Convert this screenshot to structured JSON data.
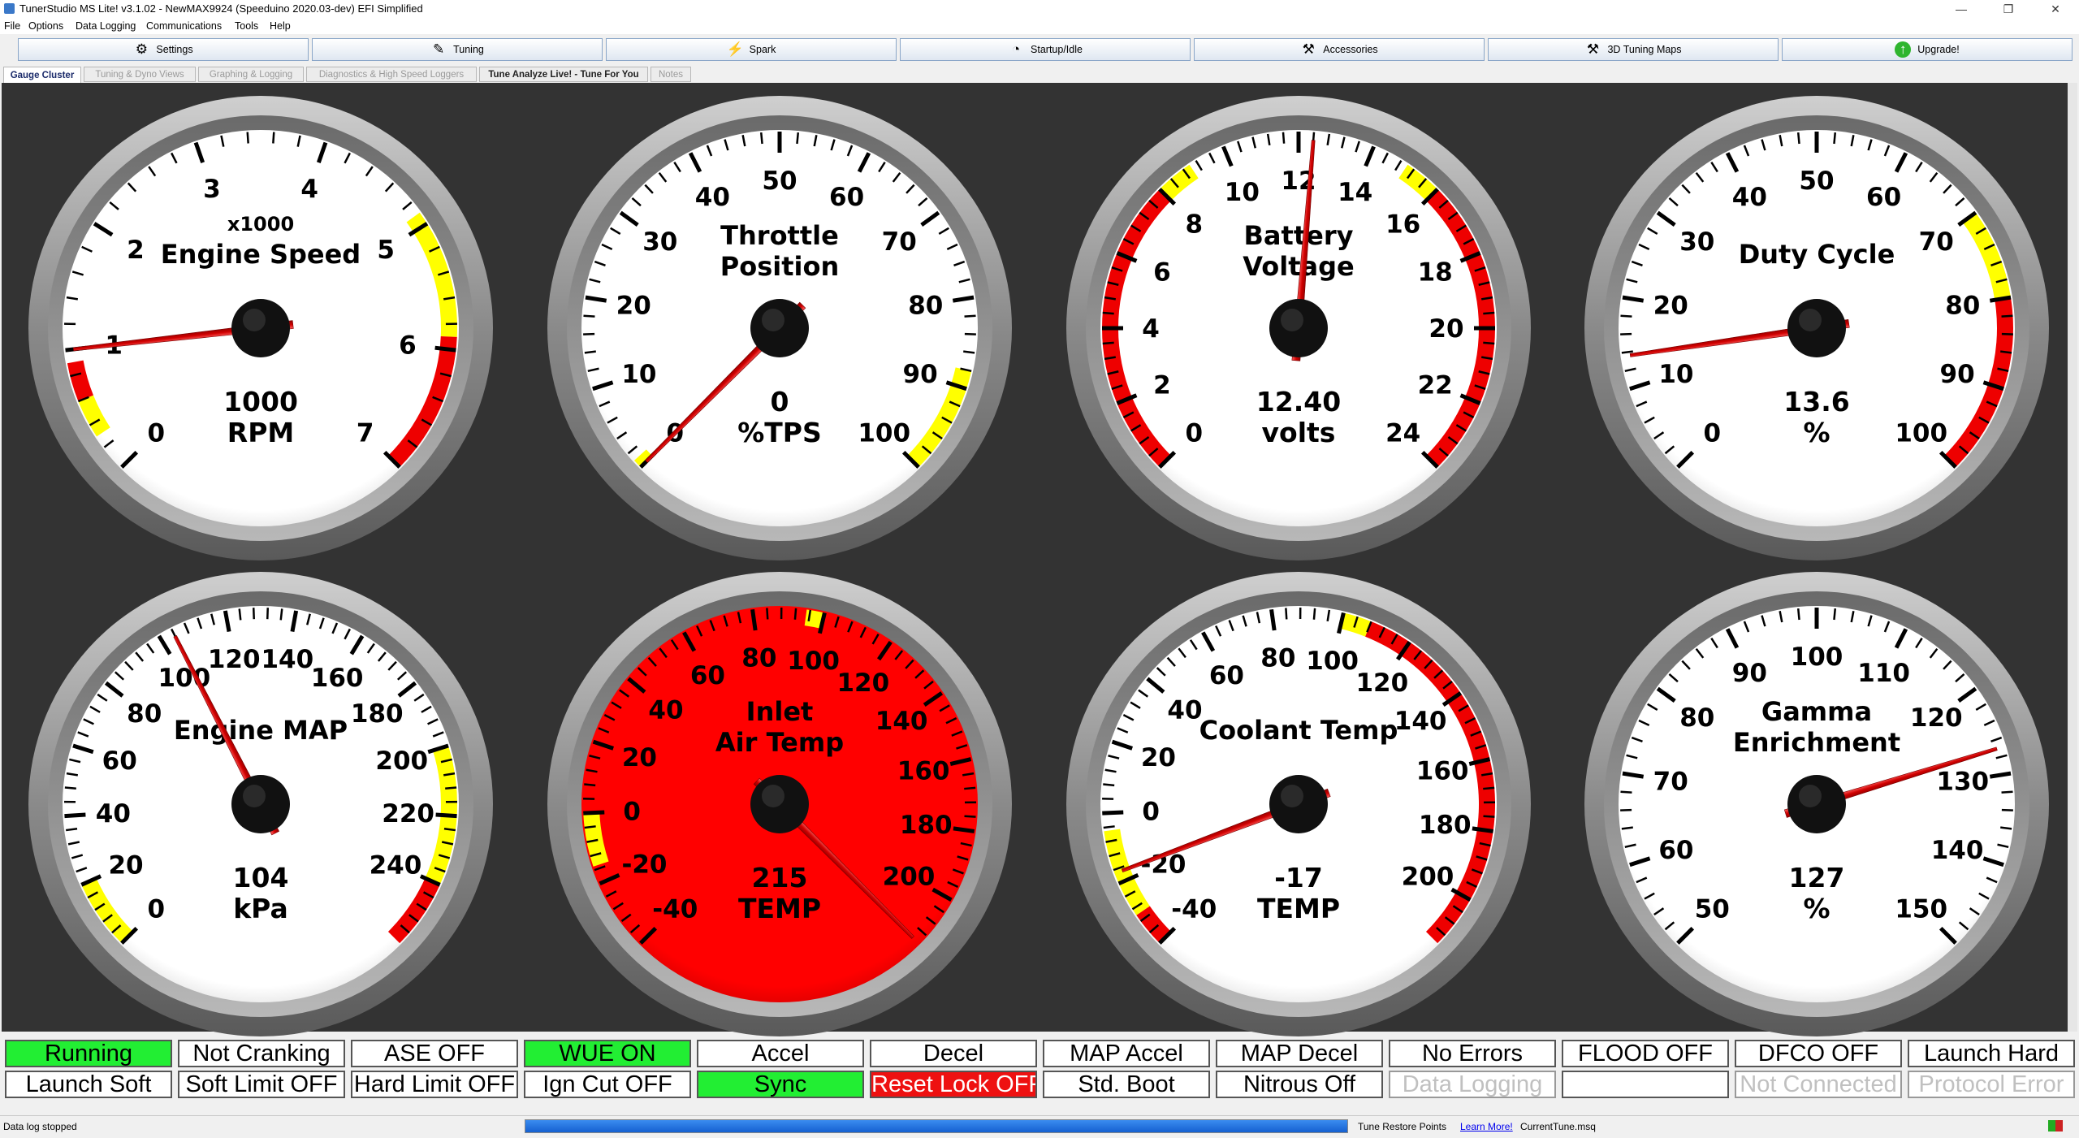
{
  "window": {
    "title": "TunerStudio MS Lite! v3.1.02 - NewMAX9924 (Speeduino 2020.03-dev) EFI Simplified",
    "controls": [
      "—",
      "❐",
      "✕"
    ]
  },
  "menu": [
    "File",
    "Options",
    "Data Logging",
    "Communications",
    "Tools",
    "Help"
  ],
  "toolbar": [
    {
      "label": "Settings",
      "icon": "⚙"
    },
    {
      "label": "Tuning",
      "icon": "✎"
    },
    {
      "label": "Spark",
      "icon": "⚡"
    },
    {
      "label": "Startup/Idle",
      "icon": "◔"
    },
    {
      "label": "Accessories",
      "icon": "⚒"
    },
    {
      "label": "3D Tuning Maps",
      "icon": "⚒"
    },
    {
      "label": "Upgrade!",
      "icon": "↑"
    }
  ],
  "tabs": [
    "Gauge Cluster",
    "Tuning & Dyno Views",
    "Graphing & Logging",
    "Diagnostics & High Speed Loggers",
    "Tune Analyze Live! - Tune For You",
    "Notes"
  ],
  "gauges": [
    {
      "title": [
        "Engine Speed"
      ],
      "subtitle": "x1000",
      "min": 0,
      "max": 7,
      "labels": [
        "0",
        "1",
        "2",
        "3",
        "4",
        "5",
        "6",
        "7"
      ],
      "value": 1.0,
      "value_text": "1000",
      "units": "RPM",
      "bands": [
        {
          "from": 0.3,
          "to": 0.6,
          "color": "#ffff00"
        },
        {
          "from": 0.6,
          "to": 0.9,
          "color": "#ee0000"
        },
        {
          "from": 4.9,
          "to": 5.9,
          "color": "#ffff00"
        },
        {
          "from": 5.9,
          "to": 7,
          "color": "#ee0000"
        }
      ],
      "face": "#ffffff"
    },
    {
      "title": [
        "Throttle",
        "Position"
      ],
      "subtitle": "",
      "min": 0,
      "max": 100,
      "labels": [
        "0",
        "10",
        "20",
        "30",
        "40",
        "50",
        "60",
        "70",
        "80",
        "90",
        "100"
      ],
      "value": 0,
      "value_text": "0",
      "units": "%TPS",
      "bands": [
        {
          "from": 0,
          "to": 1,
          "color": "#ffff00"
        },
        {
          "from": 88,
          "to": 100,
          "color": "#ffff00"
        }
      ],
      "face": "#ffffff"
    },
    {
      "title": [
        "Battery",
        "Voltage"
      ],
      "subtitle": "",
      "min": 0,
      "max": 24,
      "labels": [
        "0",
        "2",
        "4",
        "6",
        "8",
        "10",
        "12",
        "14",
        "16",
        "18",
        "20",
        "22",
        "24"
      ],
      "value": 12.4,
      "value_text": "12.40",
      "units": "volts",
      "bands": [
        {
          "from": 0,
          "to": 8,
          "color": "#ee0000"
        },
        {
          "from": 8,
          "to": 9,
          "color": "#ffff00"
        },
        {
          "from": 15,
          "to": 16,
          "color": "#ffff00"
        },
        {
          "from": 16,
          "to": 24,
          "color": "#ee0000"
        }
      ],
      "face": "#ffffff"
    },
    {
      "title": [
        "Duty Cycle"
      ],
      "subtitle": "",
      "min": 0,
      "max": 100,
      "labels": [
        "0",
        "10",
        "20",
        "30",
        "40",
        "50",
        "60",
        "70",
        "80",
        "90",
        "100"
      ],
      "value": 13.6,
      "value_text": "13.6",
      "units": "%",
      "bands": [
        {
          "from": 70,
          "to": 80,
          "color": "#ffff00"
        },
        {
          "from": 80,
          "to": 100,
          "color": "#ee0000"
        }
      ],
      "face": "#ffffff"
    },
    {
      "title": [
        "Engine MAP"
      ],
      "subtitle": "",
      "min": 0,
      "max": 260,
      "labels": [
        "0",
        "20",
        "40",
        "60",
        "80",
        "100",
        "120",
        "140",
        "160",
        "180",
        "200",
        "220",
        "240"
      ],
      "label_values": [
        0,
        20,
        40,
        60,
        80,
        100,
        120,
        140,
        160,
        180,
        200,
        220,
        240
      ],
      "value": 104,
      "value_text": "104",
      "units": "kPa",
      "bands": [
        {
          "from": 0,
          "to": 20,
          "color": "#ffff00"
        },
        {
          "from": 200,
          "to": 240,
          "color": "#ffff00"
        },
        {
          "from": 240,
          "to": 260,
          "color": "#ee0000"
        }
      ],
      "face": "#ffffff"
    },
    {
      "title": [
        "Inlet",
        "Air Temp"
      ],
      "subtitle": "",
      "min": -40,
      "max": 215,
      "labels": [
        "-40",
        "-20",
        "0",
        "20",
        "40",
        "60",
        "80",
        "100",
        "120",
        "140",
        "160",
        "180",
        "200"
      ],
      "label_values": [
        -40,
        -20,
        0,
        20,
        40,
        60,
        80,
        100,
        120,
        140,
        160,
        180,
        200
      ],
      "value": 215,
      "value_text": "215",
      "units": "TEMP",
      "bands": [
        {
          "from": -15,
          "to": 0,
          "color": "#ffff00"
        },
        {
          "from": 95,
          "to": 100,
          "color": "#ffff00"
        }
      ],
      "face": "#ff0000"
    },
    {
      "title": [
        "Coolant Temp"
      ],
      "subtitle": "",
      "min": -40,
      "max": 215,
      "labels": [
        "-40",
        "-20",
        "0",
        "20",
        "40",
        "60",
        "80",
        "100",
        "120",
        "140",
        "160",
        "180",
        "200"
      ],
      "label_values": [
        -40,
        -20,
        0,
        20,
        40,
        60,
        80,
        100,
        120,
        140,
        160,
        180,
        200
      ],
      "value": -17,
      "value_text": "-17",
      "units": "TEMP",
      "bands": [
        {
          "from": -30,
          "to": -5,
          "color": "#ffff00"
        },
        {
          "from": 100,
          "to": 108,
          "color": "#ffff00"
        },
        {
          "from": 108,
          "to": 215,
          "color": "#ee0000"
        },
        {
          "from": -40,
          "to": -30,
          "color": "#ee0000"
        }
      ],
      "face": "#ffffff"
    },
    {
      "title": [
        "Gamma",
        "Enrichment"
      ],
      "subtitle": "",
      "min": 50,
      "max": 150,
      "labels": [
        "50",
        "60",
        "70",
        "80",
        "90",
        "100",
        "110",
        "120",
        "130",
        "140",
        "150"
      ],
      "value": 127,
      "value_text": "127",
      "units": "%",
      "bands": [],
      "face": "#ffffff"
    }
  ],
  "indicators": [
    [
      {
        "label": "Running",
        "state": "green"
      },
      {
        "label": "Not Cranking",
        "state": "off"
      },
      {
        "label": "ASE OFF",
        "state": "off"
      },
      {
        "label": "WUE ON",
        "state": "green"
      },
      {
        "label": "Accel",
        "state": "off"
      },
      {
        "label": "Decel",
        "state": "off"
      },
      {
        "label": "MAP Accel",
        "state": "off"
      },
      {
        "label": "MAP Decel",
        "state": "off"
      },
      {
        "label": "No Errors",
        "state": "off"
      },
      {
        "label": "FLOOD OFF",
        "state": "off"
      },
      {
        "label": "DFCO OFF",
        "state": "off"
      },
      {
        "label": "Launch Hard",
        "state": "off"
      }
    ],
    [
      {
        "label": "Launch Soft",
        "state": "off"
      },
      {
        "label": "Soft Limit OFF",
        "state": "off"
      },
      {
        "label": "Hard Limit OFF",
        "state": "off"
      },
      {
        "label": "Ign Cut OFF",
        "state": "off"
      },
      {
        "label": "Sync",
        "state": "green"
      },
      {
        "label": "Reset Lock OFF",
        "state": "red"
      },
      {
        "label": "Std. Boot",
        "state": "off"
      },
      {
        "label": "Nitrous Off",
        "state": "off"
      },
      {
        "label": "Data Logging",
        "state": "dim"
      },
      {
        "label": "",
        "state": "off"
      },
      {
        "label": "Not Connected",
        "state": "dim"
      },
      {
        "label": "Protocol Error",
        "state": "dim"
      }
    ]
  ],
  "status": {
    "left": "Data log stopped",
    "progress_fraction": 1.0,
    "restore": "Tune Restore Points",
    "learn": "Learn More!",
    "file": "CurrentTune.msq"
  }
}
